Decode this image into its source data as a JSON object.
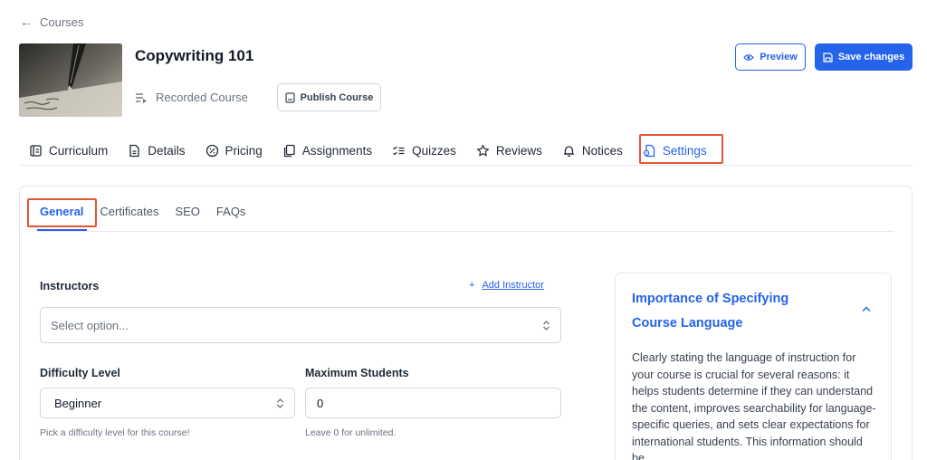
{
  "nav": {
    "back_label": "Courses"
  },
  "course": {
    "title": "Copywriting 101",
    "type_label": "Recorded Course",
    "publish_label": "Publish Course"
  },
  "actions": {
    "preview_label": "Preview",
    "save_label": "Save changes"
  },
  "main_tabs": [
    {
      "label": "Curriculum",
      "icon": "curriculum-icon"
    },
    {
      "label": "Details",
      "icon": "document-icon"
    },
    {
      "label": "Pricing",
      "icon": "pricing-icon"
    },
    {
      "label": "Assignments",
      "icon": "copy-icon"
    },
    {
      "label": "Quizzes",
      "icon": "checklist-icon"
    },
    {
      "label": "Reviews",
      "icon": "star-icon"
    },
    {
      "label": "Notices",
      "icon": "bell-icon"
    },
    {
      "label": "Settings",
      "icon": "settings-doc-icon",
      "active": true
    }
  ],
  "sub_tabs": [
    {
      "label": "General",
      "active": true
    },
    {
      "label": "Certificates"
    },
    {
      "label": "SEO"
    },
    {
      "label": "FAQs"
    }
  ],
  "form": {
    "instructors_label": "Instructors",
    "add_instructor_label": "Add Instructor",
    "instructors_placeholder": "Select option...",
    "difficulty_label": "Difficulty Level",
    "difficulty_value": "Beginner",
    "difficulty_help": "Pick a difficulty level for this course!",
    "max_students_label": "Maximum Students",
    "max_students_value": "0",
    "max_students_help": "Leave 0 for unlimited."
  },
  "info_card": {
    "title": "Importance of Specifying Course Language",
    "body": "Clearly stating the language of instruction for your course is crucial for several reasons: it helps students determine if they can understand the content, improves searchability for language-specific queries, and sets clear expectations for international students. This information should be"
  },
  "colors": {
    "accent": "#2563eb",
    "highlight": "#e25535"
  }
}
